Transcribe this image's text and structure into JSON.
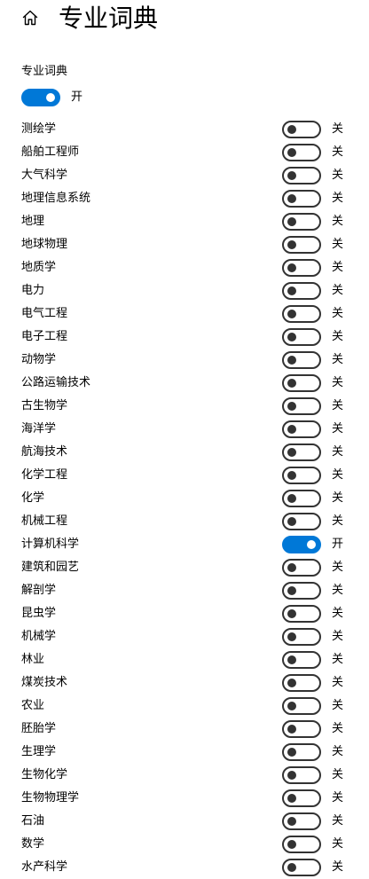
{
  "header": {
    "home_icon": "home-icon",
    "title": "专业词典"
  },
  "master": {
    "label": "专业词典",
    "on": true,
    "state_text": "开"
  },
  "state_labels": {
    "on": "开",
    "off": "关"
  },
  "colors": {
    "accent": "#0078d7",
    "toggle_off": "#333333"
  },
  "items": [
    {
      "label": "测绘学",
      "on": false,
      "state_text": "关"
    },
    {
      "label": "船舶工程师",
      "on": false,
      "state_text": "关"
    },
    {
      "label": "大气科学",
      "on": false,
      "state_text": "关"
    },
    {
      "label": "地理信息系统",
      "on": false,
      "state_text": "关"
    },
    {
      "label": "地理",
      "on": false,
      "state_text": "关"
    },
    {
      "label": "地球物理",
      "on": false,
      "state_text": "关"
    },
    {
      "label": "地质学",
      "on": false,
      "state_text": "关"
    },
    {
      "label": "电力",
      "on": false,
      "state_text": "关"
    },
    {
      "label": "电气工程",
      "on": false,
      "state_text": "关"
    },
    {
      "label": "电子工程",
      "on": false,
      "state_text": "关"
    },
    {
      "label": "动物学",
      "on": false,
      "state_text": "关"
    },
    {
      "label": "公路运输技术",
      "on": false,
      "state_text": "关"
    },
    {
      "label": "古生物学",
      "on": false,
      "state_text": "关"
    },
    {
      "label": "海洋学",
      "on": false,
      "state_text": "关"
    },
    {
      "label": "航海技术",
      "on": false,
      "state_text": "关"
    },
    {
      "label": "化学工程",
      "on": false,
      "state_text": "关"
    },
    {
      "label": "化学",
      "on": false,
      "state_text": "关"
    },
    {
      "label": "机械工程",
      "on": false,
      "state_text": "关"
    },
    {
      "label": "计算机科学",
      "on": true,
      "state_text": "开"
    },
    {
      "label": "建筑和园艺",
      "on": false,
      "state_text": "关"
    },
    {
      "label": "解剖学",
      "on": false,
      "state_text": "关"
    },
    {
      "label": "昆虫学",
      "on": false,
      "state_text": "关"
    },
    {
      "label": "机械学",
      "on": false,
      "state_text": "关"
    },
    {
      "label": "林业",
      "on": false,
      "state_text": "关"
    },
    {
      "label": "煤炭技术",
      "on": false,
      "state_text": "关"
    },
    {
      "label": "农业",
      "on": false,
      "state_text": "关"
    },
    {
      "label": "胚胎学",
      "on": false,
      "state_text": "关"
    },
    {
      "label": "生理学",
      "on": false,
      "state_text": "关"
    },
    {
      "label": "生物化学",
      "on": false,
      "state_text": "关"
    },
    {
      "label": "生物物理学",
      "on": false,
      "state_text": "关"
    },
    {
      "label": "石油",
      "on": false,
      "state_text": "关"
    },
    {
      "label": "数学",
      "on": false,
      "state_text": "关"
    },
    {
      "label": "水产科学",
      "on": false,
      "state_text": "关"
    }
  ]
}
